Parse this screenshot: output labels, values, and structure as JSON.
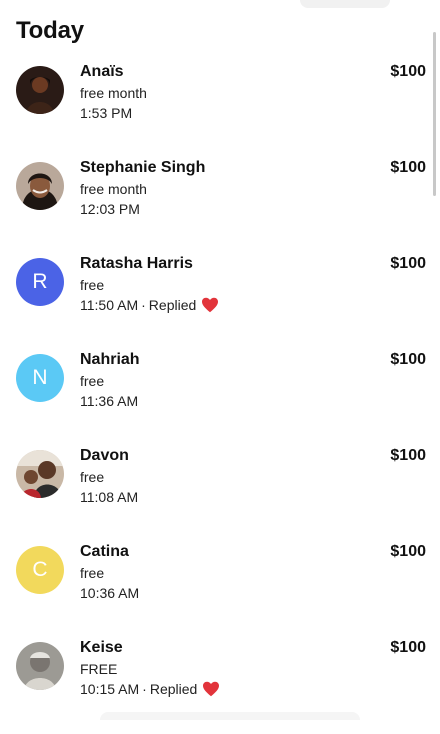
{
  "section": {
    "title": "Today"
  },
  "items": [
    {
      "name": "Anaïs",
      "plan": "free month",
      "time": "1:53 PM",
      "amount": "$100",
      "avatar": {
        "type": "photo",
        "icon": "user-photo-icon"
      }
    },
    {
      "name": "Stephanie Singh",
      "plan": "free month",
      "time": "12:03 PM",
      "amount": "$100",
      "avatar": {
        "type": "photo",
        "icon": "user-photo-icon"
      }
    },
    {
      "name": "Ratasha Harris",
      "plan": "free",
      "time": "11:50 AM",
      "status": "Replied",
      "status_icon": "heart-icon",
      "amount": "$100",
      "avatar": {
        "type": "initial",
        "letter": "R",
        "color": "#4B63E6"
      }
    },
    {
      "name": "Nahriah",
      "plan": "free",
      "time": "11:36 AM",
      "amount": "$100",
      "avatar": {
        "type": "initial",
        "letter": "N",
        "color": "#5BC9F5"
      }
    },
    {
      "name": "Davon",
      "plan": "free",
      "time": "11:08 AM",
      "amount": "$100",
      "avatar": {
        "type": "photo",
        "icon": "user-photo-icon"
      }
    },
    {
      "name": "Catina",
      "plan": "free",
      "time": "10:36 AM",
      "amount": "$100",
      "avatar": {
        "type": "initial",
        "letter": "C",
        "color": "#F2D95C"
      }
    },
    {
      "name": "Keise",
      "plan": "FREE",
      "time": "10:15 AM",
      "status": "Replied",
      "status_icon": "heart-icon",
      "amount": "$100",
      "avatar": {
        "type": "photo",
        "icon": "user-photo-icon"
      }
    }
  ],
  "separator": "·",
  "colors": {
    "heart": "#E2343B",
    "text": "#111111"
  }
}
